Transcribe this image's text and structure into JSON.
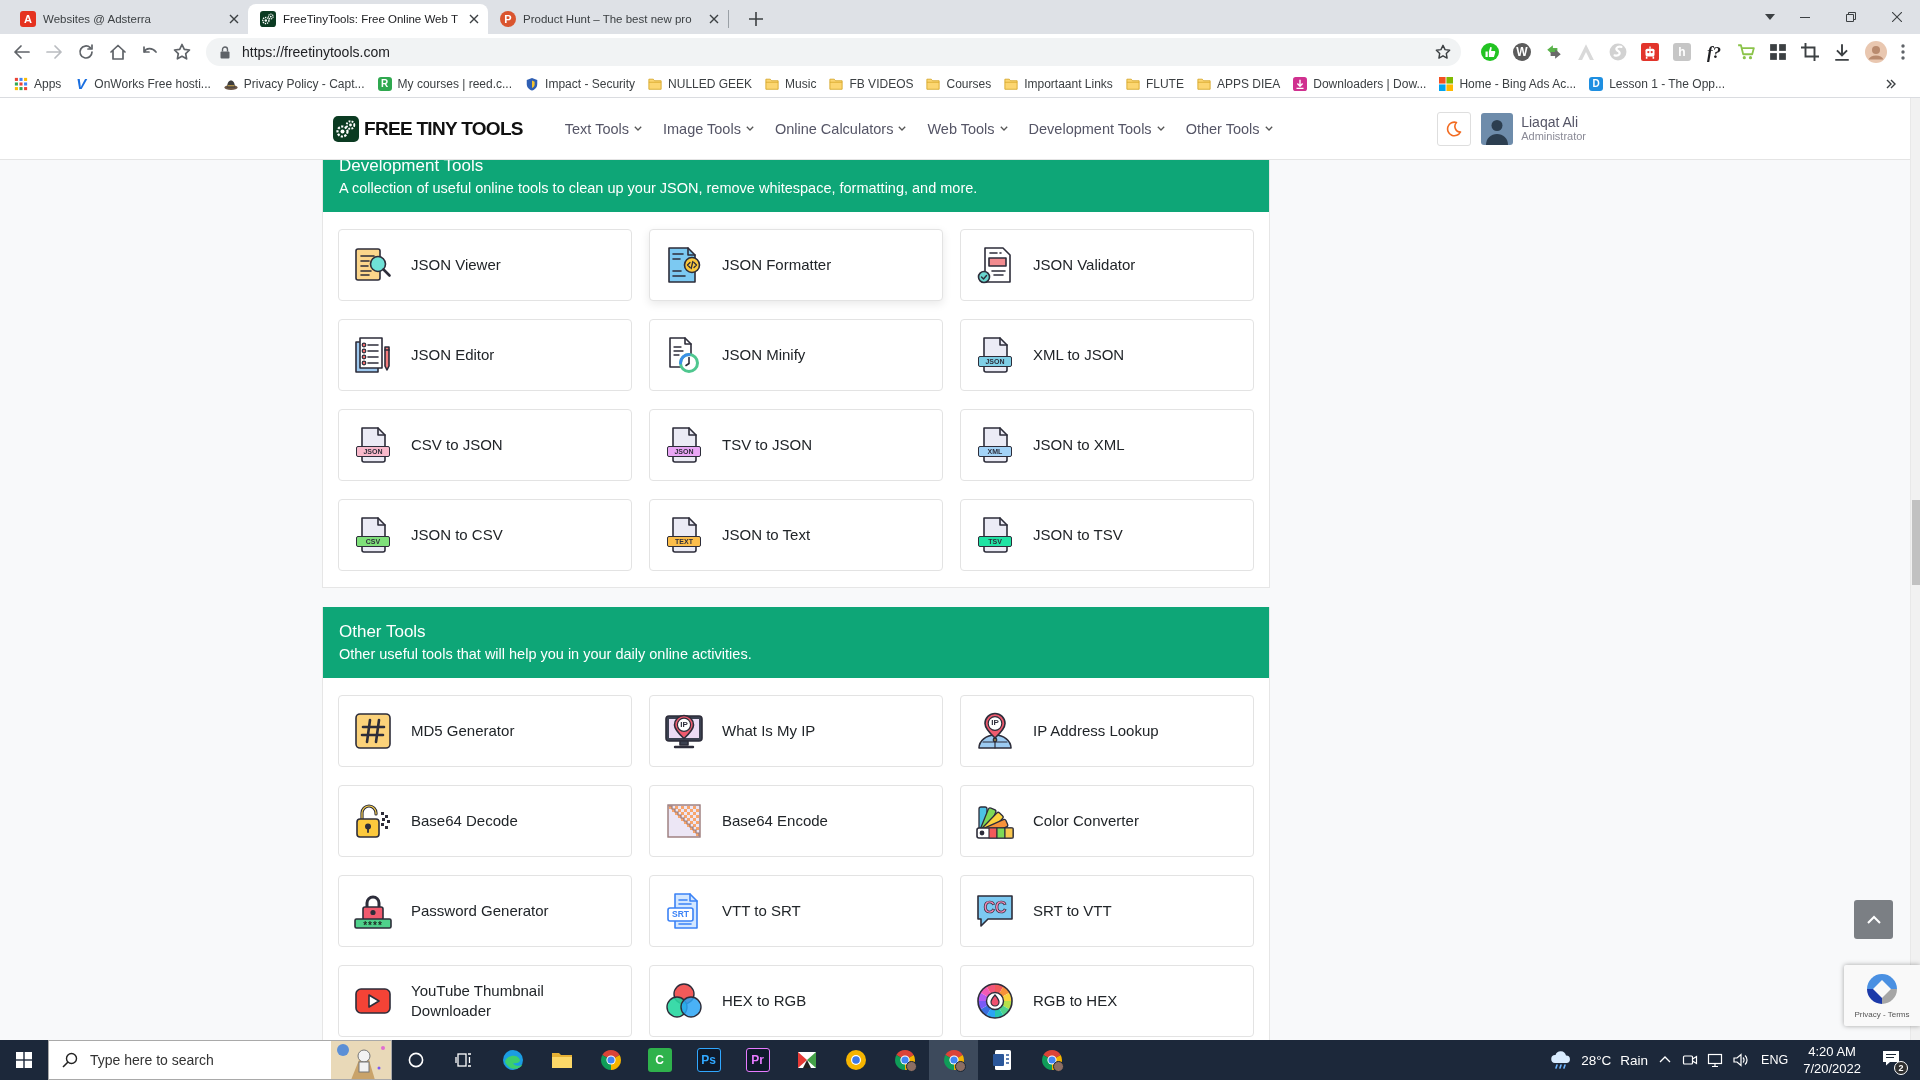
{
  "browser": {
    "tabs": [
      {
        "title": "Websites @ Adsterra",
        "kind": "letter-tile",
        "icon_letter": "A",
        "color": "#e5321f",
        "selected": false
      },
      {
        "title": "FreeTinyTools: Free Online Web T",
        "kind": "gears",
        "selected": true
      },
      {
        "title": "Product Hunt – The best new pro",
        "kind": "letter-circle",
        "icon_letter": "P",
        "color": "#da552f",
        "selected": false
      }
    ],
    "forward_disabled": true,
    "url": "https://freetinytools.com",
    "extensions": [
      {
        "kind": "thumbs-up"
      },
      {
        "kind": "letter-circle",
        "icon_letter": "W",
        "color": "#5c5c5c"
      },
      {
        "kind": "arrows"
      },
      {
        "kind": "peak"
      },
      {
        "kind": "swirl"
      },
      {
        "kind": "robot"
      },
      {
        "kind": "letter-tile",
        "icon_letter": "h",
        "color": "#c6c6c6"
      },
      {
        "kind": "letter-plain",
        "icon_letter": "f?",
        "color": "#202124"
      },
      {
        "kind": "cart"
      },
      {
        "kind": "grid"
      },
      {
        "kind": "crop"
      },
      {
        "kind": "download"
      }
    ],
    "bookmarks": [
      {
        "label": "Apps",
        "kind": "apps"
      },
      {
        "label": "OnWorks Free hosti...",
        "kind": "letter-plain",
        "icon_letter": "V",
        "color": "#1a6fe0"
      },
      {
        "label": "Privacy Policy - Capt...",
        "kind": "hat"
      },
      {
        "label": "My courses | reed.c...",
        "kind": "letter-tile",
        "icon_letter": "R",
        "color": "#2fa84f"
      },
      {
        "label": "Impact - Security",
        "kind": "shield"
      },
      {
        "label": "NULLED GEEK",
        "kind": "folder"
      },
      {
        "label": "Music",
        "kind": "folder"
      },
      {
        "label": "FB VIDEOS",
        "kind": "folder"
      },
      {
        "label": "Courses",
        "kind": "folder"
      },
      {
        "label": "Importaant Links",
        "kind": "folder"
      },
      {
        "label": "FLUTE",
        "kind": "folder"
      },
      {
        "label": "APPS DIEA",
        "kind": "folder"
      },
      {
        "label": "Downloaders | Dow...",
        "kind": "download-tile"
      },
      {
        "label": "Home - Bing Ads Ac...",
        "kind": "four-squares"
      },
      {
        "label": "Lesson 1 - The Opp...",
        "kind": "letter-tile",
        "icon_letter": "D",
        "color": "#1e8fe1"
      }
    ]
  },
  "site": {
    "logo": "FREE TINY TOOLS",
    "nav": [
      {
        "label": "Text Tools"
      },
      {
        "label": "Image Tools"
      },
      {
        "label": "Online Calculators"
      },
      {
        "label": "Web Tools"
      },
      {
        "label": "Development Tools"
      },
      {
        "label": "Other Tools"
      }
    ],
    "user": {
      "name": "Liaqat Ali",
      "role": "Administrator"
    }
  },
  "sections": [
    {
      "title": "Development Tools",
      "description": "A collection of useful online tools to clean up your JSON, remove whitespace, formatting, and more.",
      "tools": [
        {
          "name": "JSON Viewer",
          "kind": "viewer",
          "hovered": false
        },
        {
          "name": "JSON Formatter",
          "kind": "formatter",
          "hovered": true
        },
        {
          "name": "JSON Validator",
          "kind": "validator",
          "hovered": false
        },
        {
          "name": "JSON Editor",
          "kind": "editor",
          "hovered": false
        },
        {
          "name": "JSON Minify",
          "kind": "minify",
          "hovered": false
        },
        {
          "name": "XML to JSON",
          "kind": "file",
          "badge": "JSON",
          "color": "#7fcfe6",
          "hovered": false
        },
        {
          "name": "CSV to JSON",
          "kind": "file",
          "badge": "JSON",
          "color": "#f9b9cb",
          "hovered": false
        },
        {
          "name": "TSV to JSON",
          "kind": "file",
          "badge": "JSON",
          "color": "#eaa6f5",
          "hovered": false
        },
        {
          "name": "JSON to XML",
          "kind": "file",
          "badge": "XML",
          "color": "#a3d3f7",
          "hovered": false
        },
        {
          "name": "JSON to CSV",
          "kind": "file",
          "badge": "CSV",
          "color": "#7fe07a",
          "hovered": false
        },
        {
          "name": "JSON to Text",
          "kind": "file",
          "badge": "TEXT",
          "color": "#fbbd4a",
          "hovered": false
        },
        {
          "name": "JSON to TSV",
          "kind": "file",
          "badge": "TSV",
          "color": "#1fe3a3",
          "hovered": false
        }
      ]
    },
    {
      "title": "Other Tools",
      "description": "Other useful tools that will help you in your daily online activities.",
      "tools": [
        {
          "name": "MD5 Generator",
          "kind": "hash",
          "hovered": false
        },
        {
          "name": "What Is My IP",
          "kind": "monitor-pin",
          "badge": "IP",
          "hovered": false
        },
        {
          "name": "IP Address Lookup",
          "kind": "globe-pin",
          "badge": "IP",
          "hovered": false
        },
        {
          "name": "Base64 Decode",
          "kind": "open-lock",
          "hovered": false
        },
        {
          "name": "Base64 Encode",
          "kind": "checker",
          "hovered": false
        },
        {
          "name": "Color Converter",
          "kind": "swatches",
          "hovered": false
        },
        {
          "name": "Password Generator",
          "kind": "lock-bar",
          "badge": "****",
          "hovered": false
        },
        {
          "name": "VTT to SRT",
          "kind": "srt-doc",
          "badge": "SRT",
          "hovered": false
        },
        {
          "name": "SRT to VTT",
          "kind": "speech-cc",
          "badge": "CC",
          "hovered": false
        },
        {
          "name": "YouTube Thumbnail Downloader",
          "kind": "youtube",
          "hovered": false
        },
        {
          "name": "HEX to RGB",
          "kind": "venn",
          "hovered": false
        },
        {
          "name": "RGB to HEX",
          "kind": "wheel",
          "hovered": false
        }
      ]
    }
  ],
  "recaptcha": {
    "links": "Privacy - Terms"
  },
  "taskbar": {
    "search_placeholder": "Type here to search",
    "apps": [
      {
        "kind": "edge",
        "selected": false
      },
      {
        "kind": "folder",
        "selected": false
      },
      {
        "kind": "chrome",
        "selected": false
      },
      {
        "kind": "letter-tile",
        "icon_letter": "C",
        "color": "#2fb24c",
        "selected": false
      },
      {
        "kind": "dark-tile",
        "icon_letter": "Ps",
        "color": "#31a8ff",
        "selected": false
      },
      {
        "kind": "dark-tile",
        "icon_letter": "Pr",
        "color": "#e77bff",
        "selected": false
      },
      {
        "kind": "colorful",
        "selected": false
      },
      {
        "kind": "browser-alt",
        "selected": false
      },
      {
        "kind": "chrome-profile",
        "selected": false
      },
      {
        "kind": "chrome-profile",
        "selected": true
      },
      {
        "kind": "document",
        "selected": false
      },
      {
        "kind": "chrome-profile",
        "selected": false
      }
    ],
    "temperature": "28°C",
    "condition": "Rain",
    "language": "ENG",
    "time": "4:20 AM",
    "date": "7/20/2022",
    "notifications": "2"
  }
}
